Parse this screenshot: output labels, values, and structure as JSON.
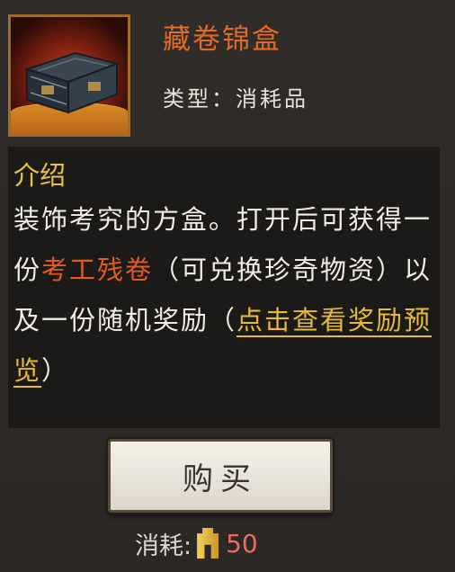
{
  "item": {
    "name": "藏卷锦盒",
    "type_label": "类型：",
    "type_value": "消耗品",
    "icon": "ornate-chest-icon"
  },
  "description": {
    "heading": "介绍",
    "part1": "装饰考究的方盒。打开后可获得一份",
    "highlight": "考工残卷",
    "part2": "（可兑换珍奇物资）以及一份随机奖励（",
    "link": "点击查看奖励预览",
    "part3": "）"
  },
  "buy_button": {
    "label": "购买"
  },
  "cost": {
    "label": "消耗:",
    "icon": "currency-icon",
    "value": "50"
  },
  "colors": {
    "title": "#e06a28",
    "heading": "#e6c24a",
    "highlight": "#e35a22",
    "link": "#e8b93a",
    "cost_value": "#ec6a5e"
  }
}
